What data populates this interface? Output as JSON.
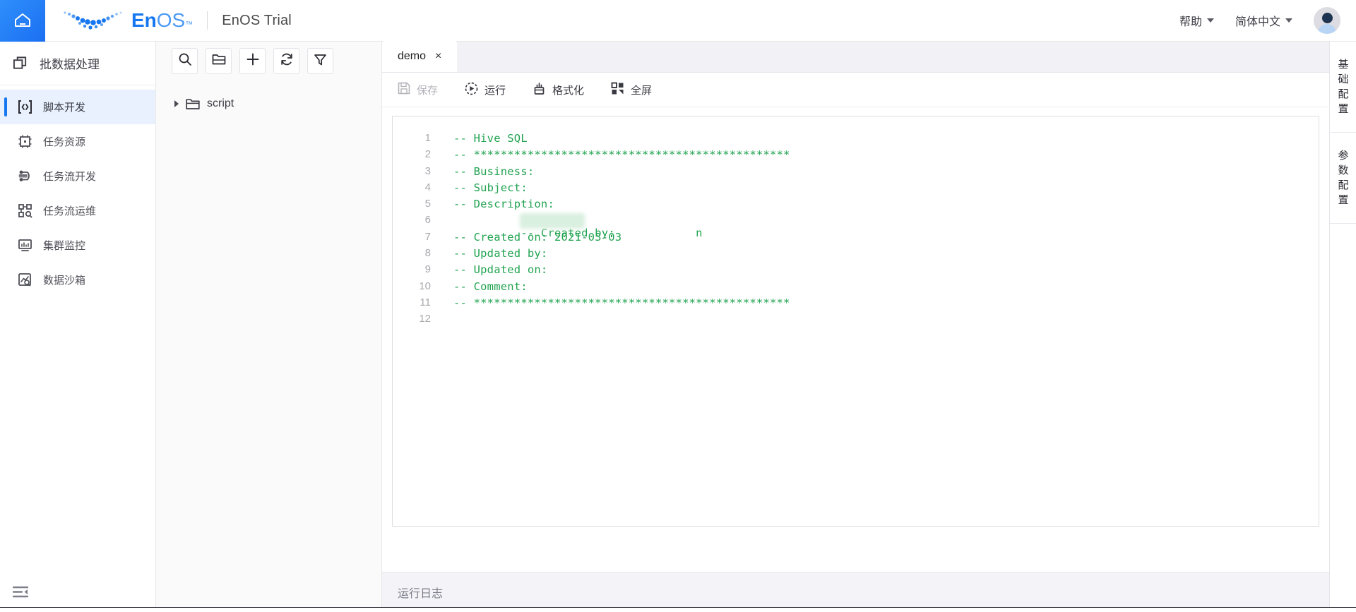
{
  "header": {
    "home_icon": "home-icon",
    "brand_name": "EnOS",
    "brand_tm": "™",
    "app_title": "EnOS Trial",
    "help_label": "帮助",
    "lang_label": "简体中文",
    "avatar_icon": "user-avatar-icon"
  },
  "sidebar": {
    "module_title": "批数据处理",
    "module_icon": "batch-data-icon",
    "items": [
      {
        "label": "脚本开发",
        "icon": "script-dev-icon",
        "active": true
      },
      {
        "label": "任务资源",
        "icon": "task-resource-icon",
        "active": false
      },
      {
        "label": "任务流开发",
        "icon": "workflow-dev-icon",
        "active": false
      },
      {
        "label": "任务流运维",
        "icon": "workflow-ops-icon",
        "active": false
      },
      {
        "label": "集群监控",
        "icon": "cluster-monitor-icon",
        "active": false
      },
      {
        "label": "数据沙箱",
        "icon": "data-sandbox-icon",
        "active": false
      }
    ],
    "collapse_icon": "menu-fold-icon"
  },
  "explorer": {
    "toolbar": [
      {
        "name": "search-icon",
        "title": "搜索"
      },
      {
        "name": "new-folder-icon",
        "title": "新建文件夹"
      },
      {
        "name": "plus-icon",
        "title": "新建"
      },
      {
        "name": "refresh-icon",
        "title": "刷新"
      },
      {
        "name": "filter-icon",
        "title": "筛选"
      }
    ],
    "tree": [
      {
        "label": "script",
        "icon": "folder-icon",
        "expanded": false
      }
    ]
  },
  "editor": {
    "tabs": [
      {
        "label": "demo",
        "close": "×",
        "active": true
      }
    ],
    "actions": [
      {
        "label": "保存",
        "icon": "save-icon",
        "disabled": true
      },
      {
        "label": "运行",
        "icon": "run-icon",
        "disabled": false
      },
      {
        "label": "格式化",
        "icon": "format-icon",
        "disabled": false
      },
      {
        "label": "全屏",
        "icon": "fullscreen-icon",
        "disabled": false
      }
    ],
    "code_lines": [
      {
        "n": "1",
        "text": "-- Hive SQL"
      },
      {
        "n": "2",
        "text": "-- ***********************************************"
      },
      {
        "n": "3",
        "text": "-- Business:"
      },
      {
        "n": "4",
        "text": "-- Subject:"
      },
      {
        "n": "5",
        "text": "-- Description:"
      },
      {
        "n": "6",
        "text": "-- Created by:            n",
        "redacted": true
      },
      {
        "n": "7",
        "text": "-- Created on: 2021-03-03"
      },
      {
        "n": "8",
        "text": "-- Updated by:"
      },
      {
        "n": "9",
        "text": "-- Updated on:"
      },
      {
        "n": "10",
        "text": "-- Comment:"
      },
      {
        "n": "11",
        "text": "-- ***********************************************"
      },
      {
        "n": "12",
        "text": ""
      }
    ],
    "log_label": "运行日志"
  },
  "rightbar": {
    "tabs": [
      {
        "label": "基础配置"
      },
      {
        "label": "参数配置"
      }
    ]
  },
  "colors": {
    "accent": "#1677f0",
    "code_comment": "#22a351",
    "active_bg": "#e8f1fd",
    "panel_bg": "#fafafb"
  }
}
